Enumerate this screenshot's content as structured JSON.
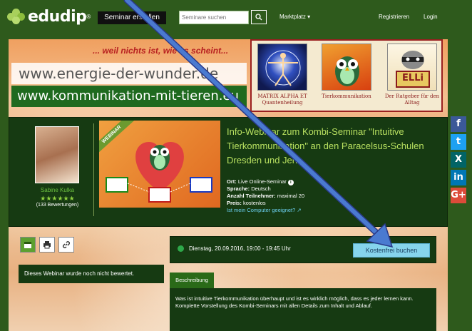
{
  "nav": {
    "logo_text": "edudip",
    "logo_reg": "®",
    "create_label": "Seminar erstellen",
    "search_placeholder": "Seminare suchen",
    "search_icon": "search-icon",
    "marketplace_label": "Marktplatz ▾",
    "register_label": "Registrieren",
    "login_label": "Login"
  },
  "banner": {
    "tagline": "... weil nichts ist, wie es scheint...",
    "url1": "www.energie-der-wunder.de",
    "url2": "www.kommunikation-mit-tieren.eu",
    "tiles": [
      {
        "caption": "MATRIX ALPHA ET Quantenheilung"
      },
      {
        "caption": "Tierkommunikation"
      },
      {
        "caption": "Der Ratgeber für den Alltag"
      }
    ],
    "elli_text": "ELLi"
  },
  "event": {
    "host_name": "Sabine Kulka",
    "stars": "★★★★★★",
    "rating_count": "(133 Bewertungen)",
    "ribbon": "WEBINAR",
    "title": "Info-Webinar zum Kombi-Seminar \"Intuitive Tierkommunikation\" an den Paracelsus-Schulen Dresden und Jena",
    "details": {
      "ort_label": "Ort:",
      "ort_value": "Live Online-Seminar",
      "sprache_label": "Sprache:",
      "sprache_value": "Deutsch",
      "teilnehmer_label": "Anzahl Teilnehmer:",
      "teilnehmer_value": "maximal 20",
      "preis_label": "Preis:",
      "preis_value": "kostenlos",
      "computer_link": "Ist mein Computer geeignet?"
    }
  },
  "date": {
    "text": "Dienstag, 20.09.2016, 19:00 - 19:45 Uhr",
    "book_label": "Kostenfrei buchen"
  },
  "no_rating": "Dieses Webinar wurde noch nicht bewertet.",
  "description": {
    "tab_label": "Beschreibung",
    "line1": "Was ist intuitive Tierkommunikation überhaupt und ist es wirklich möglich, dass es jeder lernen kann.",
    "line2": "Komplette Vorstellung des Kombi-Seminars mit allen Details zum Inhalt und Ablauf."
  },
  "social": [
    {
      "icon": "facebook-icon",
      "glyph": "f",
      "color": "#3b5998"
    },
    {
      "icon": "twitter-icon",
      "glyph": "t",
      "color": "#1da1f2"
    },
    {
      "icon": "xing-icon",
      "glyph": "X",
      "color": "#026466"
    },
    {
      "icon": "linkedin-icon",
      "glyph": "in",
      "color": "#0077b5"
    },
    {
      "icon": "googleplus-icon",
      "glyph": "G+",
      "color": "#dd4b39"
    }
  ]
}
